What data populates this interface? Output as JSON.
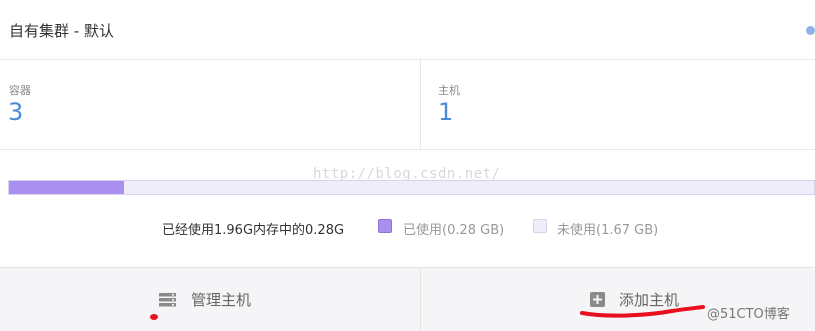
{
  "header": {
    "title": "自有集群 - 默认",
    "status_color": "#8fb3e6"
  },
  "stats": {
    "containers": {
      "label": "容器",
      "value": "3"
    },
    "hosts": {
      "label": "主机",
      "value": "1"
    }
  },
  "memory": {
    "summary": "已经使用1.96G内存中的0.28G",
    "used_fraction": 0.143,
    "legend": {
      "used": "已使用(0.28 GB)",
      "free": "未使用(1.67 GB)"
    },
    "colors": {
      "used": "#a98ff0",
      "free": "#efedf9"
    }
  },
  "footer": {
    "manage_hosts": {
      "label": "管理主机",
      "icon": "server-list-icon"
    },
    "add_host": {
      "label": "添加主机",
      "icon": "plus-square-icon"
    }
  },
  "watermark": "http://blog.csdn.net/",
  "credit": "@51CTO博客",
  "colors": {
    "accent": "#4a8ad4",
    "annotation": "#e8101e"
  }
}
